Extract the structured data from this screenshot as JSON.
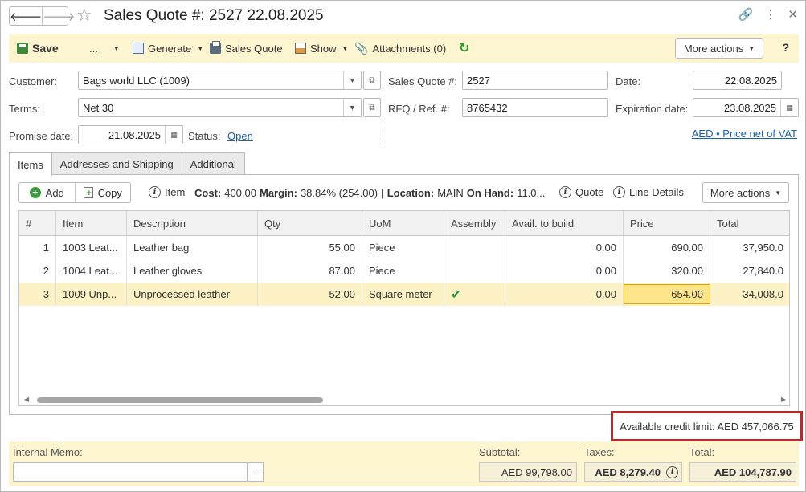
{
  "header": {
    "title": "Sales Quote #: 2527 22.08.2025"
  },
  "toolbar": {
    "save": "Save",
    "dots": "...",
    "generate": "Generate",
    "sales_quote": "Sales Quote",
    "show": "Show",
    "attachments": "Attachments (0)",
    "more_actions": "More actions",
    "help": "?"
  },
  "form": {
    "customer_label": "Customer:",
    "customer_value": "Bags world LLC (1009)",
    "terms_label": "Terms:",
    "terms_value": "Net 30",
    "promise_label": "Promise date:",
    "promise_value": "21.08.2025",
    "status_label": "Status:",
    "status_value": "Open",
    "quote_no_label": "Sales Quote #:",
    "quote_no_value": "2527",
    "rfq_label": "RFQ / Ref. #:",
    "rfq_value": "8765432",
    "date_label": "Date:",
    "date_value": "22.08.2025",
    "exp_label": "Expiration date:",
    "exp_value": "23.08.2025",
    "currency_link": "AED • Price net of VAT"
  },
  "tabs": [
    {
      "label": "Items"
    },
    {
      "label": "Addresses and Shipping"
    },
    {
      "label": "Additional"
    }
  ],
  "items_toolbar": {
    "add": "Add",
    "copy": "Copy",
    "item_info": "Item",
    "cost_label": "Cost:",
    "cost_value": "400.00",
    "margin_label": "Margin:",
    "margin_value": "38.84% (254.00)",
    "location_label": "Location:",
    "location_value": "MAIN",
    "onhand_label": "On Hand:",
    "onhand_value": "11.0...",
    "quote": "Quote",
    "line_details": "Line Details",
    "more_actions": "More actions"
  },
  "grid": {
    "columns": [
      "#",
      "Item",
      "Description",
      "Qty",
      "UoM",
      "Assembly",
      "Avail. to build",
      "Price",
      "Total"
    ],
    "rows": [
      {
        "num": "1",
        "item": "1003 Leat...",
        "description": "Leather bag",
        "qty": "55.00",
        "uom": "Piece",
        "assembly": "",
        "avail": "0.00",
        "price": "690.00",
        "total": "37,950.0"
      },
      {
        "num": "2",
        "item": "1004 Leat...",
        "description": "Leather gloves",
        "qty": "87.00",
        "uom": "Piece",
        "assembly": "",
        "avail": "0.00",
        "price": "320.00",
        "total": "27,840.0"
      },
      {
        "num": "3",
        "item": "1009 Unp...",
        "description": "Unprocessed leather",
        "qty": "52.00",
        "uom": "Square meter",
        "assembly": "✔",
        "avail": "0.00",
        "price": "654.00",
        "total": "34,008.0"
      }
    ]
  },
  "credit": {
    "text": "Available credit limit: AED 457,066.75"
  },
  "footer": {
    "memo_label": "Internal Memo:",
    "memo_value": "",
    "memo_btn": "...",
    "subtotal_label": "Subtotal:",
    "subtotal_value": "AED 99,798.00",
    "taxes_label": "Taxes:",
    "taxes_value": "AED 8,279.40",
    "total_label": "Total:",
    "total_value": "AED 104,787.90"
  },
  "colors": {
    "accent_bg": "#fcf5cf",
    "link": "#1c5fa8",
    "highlight_border": "#b52a2a"
  }
}
